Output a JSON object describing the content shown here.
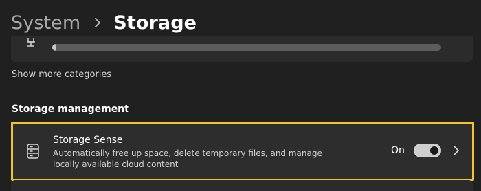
{
  "breadcrumb": {
    "parent": "System",
    "current": "Storage",
    "separator_icon": "chevron-right-icon"
  },
  "storage_usage": {
    "icon": "drive-icon",
    "used_fraction": 0.01
  },
  "show_more": {
    "label": "Show more categories"
  },
  "storage_management": {
    "heading": "Storage management",
    "highlight_color": "#f2c230",
    "items": [
      {
        "icon": "storage-drive-icon",
        "title": "Storage Sense",
        "description": "Automatically free up space, delete temporary files, and manage locally available cloud content",
        "toggle_label": "On",
        "toggle_on": true,
        "chevron_icon": "chevron-right-icon"
      }
    ]
  }
}
